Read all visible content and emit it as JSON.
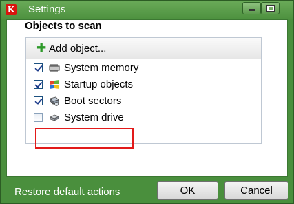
{
  "window": {
    "title": "Settings",
    "app_icon_letter": "K"
  },
  "section": {
    "title": "Objects to scan"
  },
  "toolbar": {
    "add_label": "Add object..."
  },
  "objects": [
    {
      "label": "System memory",
      "checked": true,
      "icon": "memory-chip-icon"
    },
    {
      "label": "Startup objects",
      "checked": true,
      "icon": "windows-flag-icon"
    },
    {
      "label": "Boot sectors",
      "checked": true,
      "icon": "boot-sector-icon"
    },
    {
      "label": "System drive",
      "checked": false,
      "icon": "hard-drive-icon"
    }
  ],
  "footer": {
    "restore_label": "Restore default actions",
    "ok_label": "OK",
    "cancel_label": "Cancel"
  },
  "colors": {
    "frame": "#4a8f3d",
    "highlight": "#e21a1a",
    "plus": "#2e9a2a"
  }
}
